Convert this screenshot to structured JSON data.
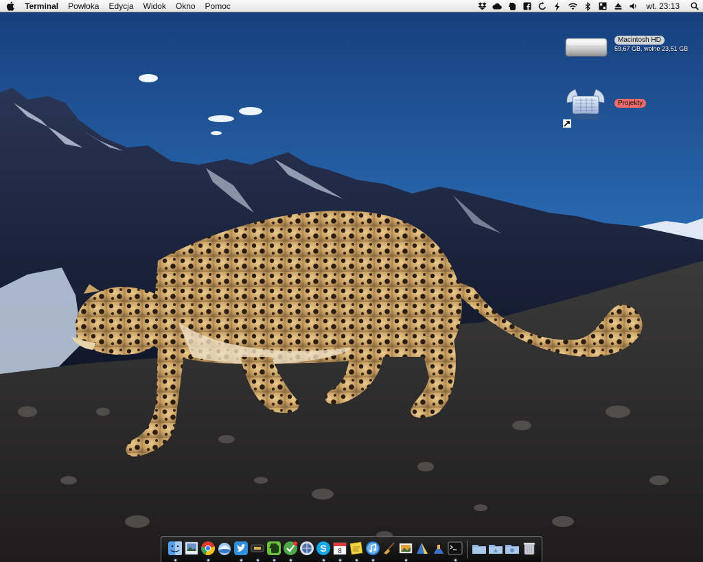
{
  "menubar": {
    "app_name": "Terminal",
    "menus": [
      "Powłoka",
      "Edycja",
      "Widok",
      "Okno",
      "Pomoc"
    ],
    "clock": "wt. 23:13",
    "status_icons": [
      "dropbox-icon",
      "cloud-icon",
      "evernote-icon",
      "facebook-icon",
      "sync-icon",
      "bolt-icon",
      "wifi-icon",
      "bluetooth-icon",
      "spaces-icon",
      "eject-icon",
      "volume-icon"
    ]
  },
  "desktop": {
    "drive": {
      "name": "Macintosh HD",
      "info": "59,67 GB, wolne 23,51 GB"
    },
    "alias": {
      "name": "Projekty"
    }
  },
  "dock": {
    "apps": [
      "finder",
      "preview",
      "chrome",
      "network",
      "twitter",
      "notes",
      "evernote",
      "omnifocus",
      "itunes-connect",
      "skype",
      "ical",
      "stickies",
      "itunes",
      "xcode-broom",
      "iphoto",
      "pixelmator",
      "transmit",
      "terminal"
    ],
    "folders": [
      "applications-folder",
      "documents-folder",
      "downloads-folder"
    ],
    "trash": "trash"
  }
}
